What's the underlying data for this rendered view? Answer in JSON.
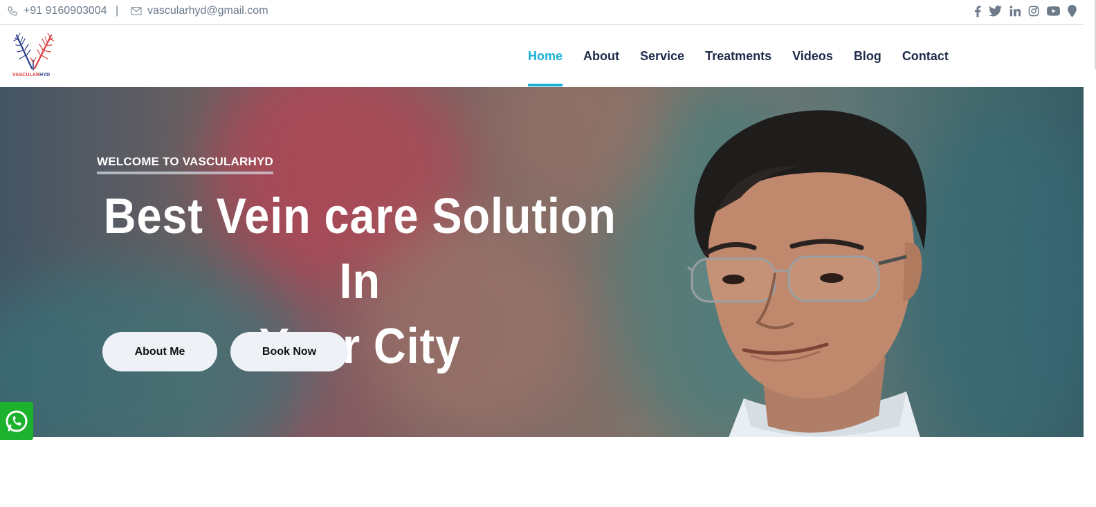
{
  "topbar": {
    "phone": "+91 9160903004",
    "divider": "|",
    "email": "vascularhyd@gmail.com",
    "icons": [
      "phone-icon",
      "mail-icon",
      "facebook-icon",
      "twitter-icon",
      "linkedin-icon",
      "instagram-icon",
      "youtube-icon",
      "map-pin-icon"
    ]
  },
  "logo": {
    "text_part1": "VASCULAR",
    "text_part2": "HYD",
    "colors": {
      "red": "#d93a3a",
      "blue": "#2c3f8a"
    }
  },
  "nav": {
    "items": [
      "Home",
      "About",
      "Service",
      "Treatments",
      "Videos",
      "Blog",
      "Contact"
    ],
    "active": "Home",
    "active_color": "#17b0d6",
    "text_color": "#1e2b4a"
  },
  "hero": {
    "subtitle": "WELCOME TO VASCULARHYD",
    "title_line1": "Best Vein care Solution In",
    "title_line2": "Your City",
    "buttons": {
      "about": "About Me",
      "book": "Book Now"
    }
  },
  "floating": {
    "whatsapp_icon": "whatsapp-icon",
    "whatsapp_color": "#1cb22d"
  }
}
